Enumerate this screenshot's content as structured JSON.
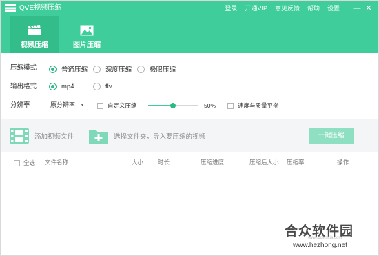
{
  "app": {
    "title": "QVE视频压缩",
    "menu": [
      "登录",
      "开通VIP",
      "意见反馈",
      "帮助",
      "设置"
    ],
    "window_buttons": [
      "—",
      "✕"
    ]
  },
  "tabs": [
    {
      "label": "视频压缩",
      "icon": "clapperboard-icon",
      "active": true
    },
    {
      "label": "图片压缩",
      "icon": "image-icon",
      "active": false
    }
  ],
  "settings": {
    "mode": {
      "label": "压缩模式",
      "options": [
        "普通压缩",
        "深度压缩",
        "极限压缩"
      ],
      "selected": "普通压缩"
    },
    "format": {
      "label": "输出格式",
      "options": [
        "mp4",
        "flv"
      ],
      "selected": "mp4"
    },
    "resolution": {
      "label": "分辨率",
      "value": "原分辨率",
      "custom_label": "自定义压缩",
      "slider_value": 50,
      "slider_text": "50%",
      "balance_label": "速度与质量平衡"
    }
  },
  "actions": {
    "add_video": "添加视频文件",
    "select_folder": "选择文件夹，导入要压缩的视频",
    "convert": "一键压缩"
  },
  "table": {
    "select_all": "全选",
    "columns": [
      "文件名称",
      "大小",
      "时长",
      "压缩进度",
      "压缩后大小",
      "压缩率",
      "操作"
    ]
  },
  "watermark": {
    "text": "合众软件园",
    "url": "www.hezhong.net",
    "small": "www.downxia.com"
  },
  "colors": {
    "accent": "#3ecd9b",
    "accent_dark": "#2db983",
    "button_light": "#8fe0c2",
    "action_bar": "#f4f5f7"
  }
}
